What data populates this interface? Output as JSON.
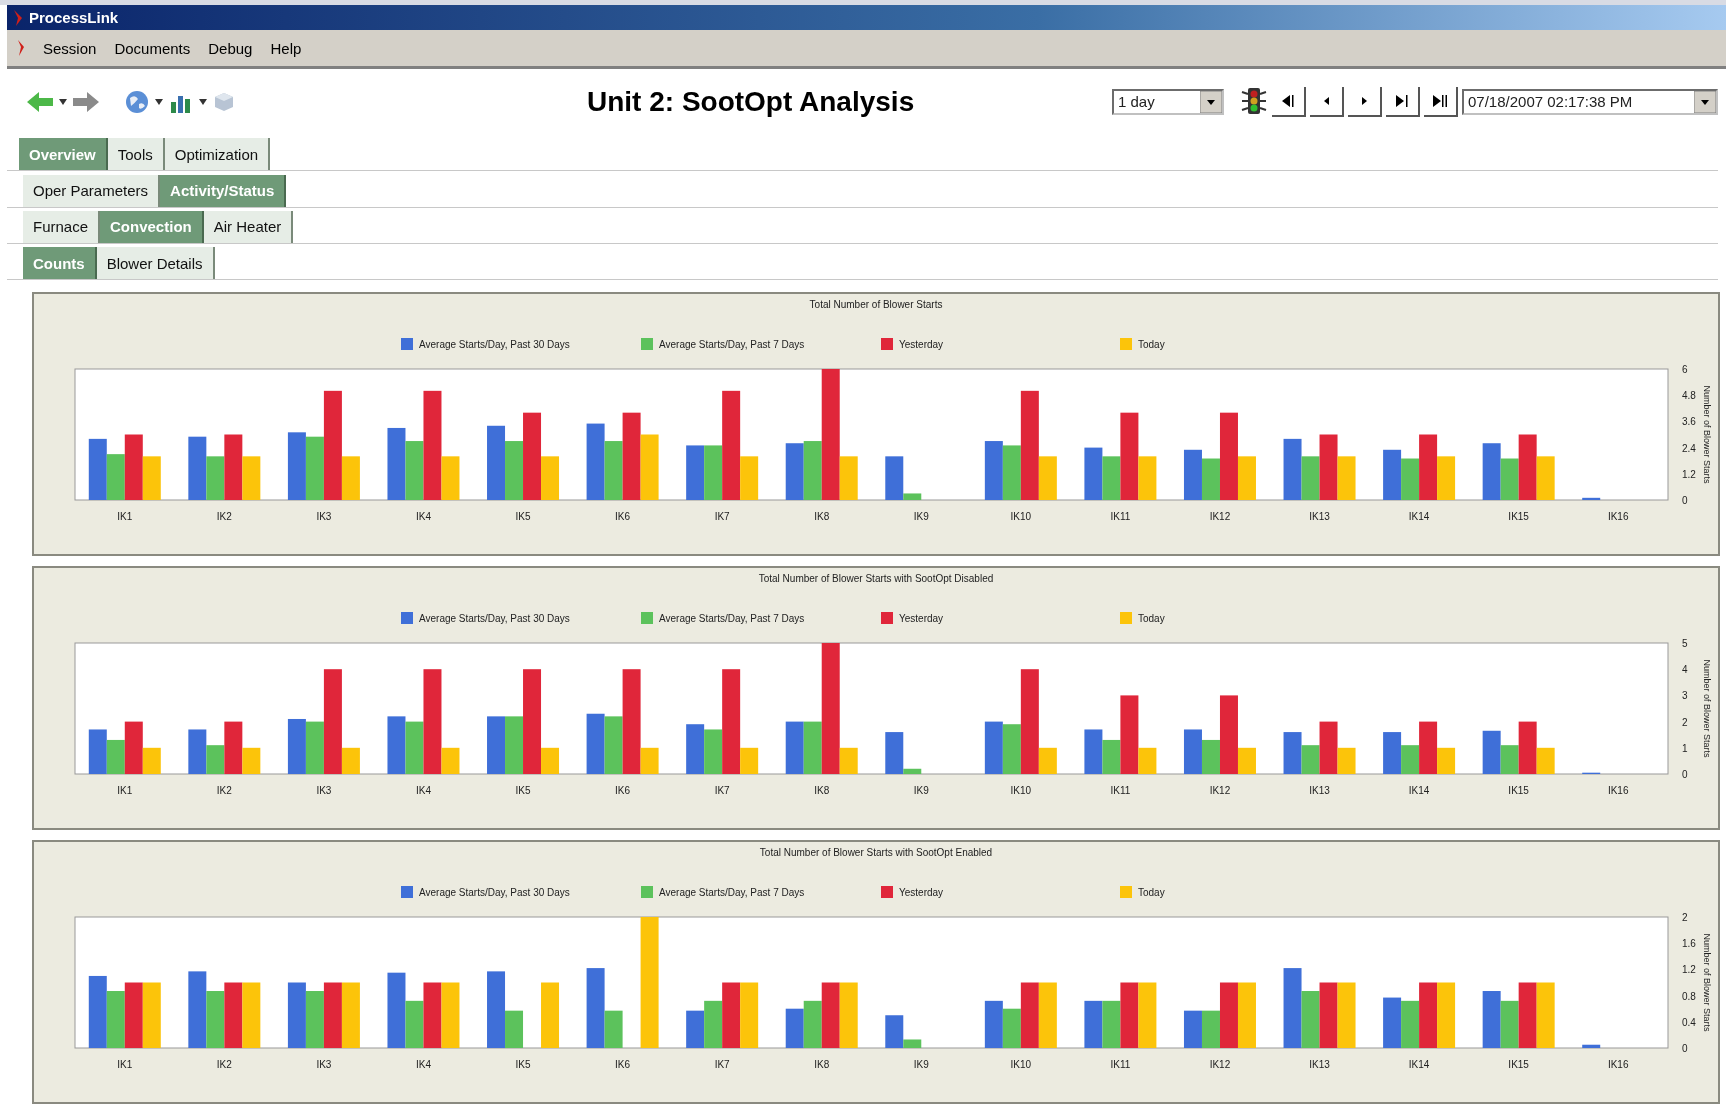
{
  "window": {
    "title": "ProcessLink"
  },
  "menu": [
    {
      "label": "Session"
    },
    {
      "label": "Documents"
    },
    {
      "label": "Debug"
    },
    {
      "label": "Help"
    }
  ],
  "page_title": "Unit 2: SootOpt Analysis",
  "time_range": {
    "value": "1 day"
  },
  "timestamp": {
    "value": "07/18/2007 02:17:38 PM"
  },
  "tab_rows": [
    [
      {
        "label": "Overview",
        "selected": true
      },
      {
        "label": "Tools",
        "selected": false
      },
      {
        "label": "Optimization",
        "selected": false
      }
    ],
    [
      {
        "label": "Oper Parameters",
        "selected": false
      },
      {
        "label": "Activity/Status",
        "selected": true
      }
    ],
    [
      {
        "label": "Furnace",
        "selected": false
      },
      {
        "label": "Convection",
        "selected": true
      },
      {
        "label": "Air Heater",
        "selected": false
      }
    ],
    [
      {
        "label": "Counts",
        "selected": true
      },
      {
        "label": "Blower Details",
        "selected": false
      }
    ]
  ],
  "charts": [
    {
      "chart_data": {
        "type": "bar",
        "title": "Total Number of Blower Starts",
        "legend": true,
        "ylabel": "Number of Blower Starts",
        "categories": [
          "IK1",
          "IK2",
          "IK3",
          "IK4",
          "IK5",
          "IK6",
          "IK7",
          "IK8",
          "IK9",
          "IK10",
          "IK11",
          "IK12",
          "IK13",
          "IK14",
          "IK15",
          "IK16"
        ],
        "ylim": [
          0,
          6
        ],
        "yticks": [
          0,
          1.2,
          2.4,
          3.6,
          4.8,
          6
        ],
        "series": [
          {
            "name": "Average Starts/Day, Past 30 Days",
            "color": "#3f6fd8",
            "values": [
              2.8,
              2.9,
              3.1,
              3.3,
              3.4,
              3.5,
              2.5,
              2.6,
              2.0,
              2.7,
              2.4,
              2.3,
              2.8,
              2.3,
              2.6,
              0.1
            ]
          },
          {
            "name": "Average Starts/Day, Past 7 Days",
            "color": "#5cc25c",
            "values": [
              2.1,
              2.0,
              2.9,
              2.7,
              2.7,
              2.7,
              2.5,
              2.7,
              0.3,
              2.5,
              2.0,
              1.9,
              2.0,
              1.9,
              1.9,
              0
            ]
          },
          {
            "name": "Yesterday",
            "color": "#e0263a",
            "values": [
              3,
              3,
              5,
              5,
              4,
              4,
              5,
              6,
              0,
              5,
              4,
              4,
              3,
              3,
              3,
              0
            ]
          },
          {
            "name": "Today",
            "color": "#fcc40a",
            "values": [
              2,
              2,
              2,
              2,
              2,
              3,
              2,
              2,
              0,
              2,
              2,
              2,
              2,
              2,
              2,
              0
            ]
          }
        ]
      }
    },
    {
      "chart_data": {
        "type": "bar",
        "title": "Total Number of Blower Starts with SootOpt Disabled",
        "legend": true,
        "ylabel": "Number of Blower Starts",
        "categories": [
          "IK1",
          "IK2",
          "IK3",
          "IK4",
          "IK5",
          "IK6",
          "IK7",
          "IK8",
          "IK9",
          "IK10",
          "IK11",
          "IK12",
          "IK13",
          "IK14",
          "IK15",
          "IK16"
        ],
        "ylim": [
          0,
          5
        ],
        "yticks": [
          0,
          1,
          2,
          3,
          4,
          5
        ],
        "series": [
          {
            "name": "Average Starts/Day, Past 30 Days",
            "color": "#3f6fd8",
            "values": [
              1.7,
              1.7,
              2.1,
              2.2,
              2.2,
              2.3,
              1.9,
              2.0,
              1.6,
              2.0,
              1.7,
              1.7,
              1.6,
              1.6,
              1.65,
              0.05
            ]
          },
          {
            "name": "Average Starts/Day, Past 7 Days",
            "color": "#5cc25c",
            "values": [
              1.3,
              1.1,
              2.0,
              2.0,
              2.2,
              2.2,
              1.7,
              2.0,
              0.2,
              1.9,
              1.3,
              1.3,
              1.1,
              1.1,
              1.1,
              0
            ]
          },
          {
            "name": "Yesterday",
            "color": "#e0263a",
            "values": [
              2,
              2,
              4,
              4,
              4,
              4,
              4,
              5,
              0,
              4,
              3,
              3,
              2,
              2,
              2,
              0
            ]
          },
          {
            "name": "Today",
            "color": "#fcc40a",
            "values": [
              1,
              1,
              1,
              1,
              1,
              1,
              1,
              1,
              0,
              1,
              1,
              1,
              1,
              1,
              1,
              0
            ]
          }
        ]
      }
    },
    {
      "chart_data": {
        "type": "bar",
        "title": "Total Number of Blower Starts with SootOpt Enabled",
        "legend": true,
        "ylabel": "Number of Blower Starts",
        "categories": [
          "IK1",
          "IK2",
          "IK3",
          "IK4",
          "IK5",
          "IK6",
          "IK7",
          "IK8",
          "IK9",
          "IK10",
          "IK11",
          "IK12",
          "IK13",
          "IK14",
          "IK15",
          "IK16"
        ],
        "ylim": [
          0,
          2
        ],
        "yticks": [
          0,
          0.4,
          0.8,
          1.2,
          1.6,
          2
        ],
        "series": [
          {
            "name": "Average Starts/Day, Past 30 Days",
            "color": "#3f6fd8",
            "values": [
              1.1,
              1.17,
              1.0,
              1.15,
              1.17,
              1.22,
              0.57,
              0.6,
              0.5,
              0.72,
              0.72,
              0.57,
              1.22,
              0.77,
              0.87,
              0.05
            ]
          },
          {
            "name": "Average Starts/Day, Past 7 Days",
            "color": "#5cc25c",
            "values": [
              0.87,
              0.87,
              0.87,
              0.72,
              0.57,
              0.57,
              0.72,
              0.72,
              0.13,
              0.6,
              0.72,
              0.57,
              0.87,
              0.72,
              0.72,
              0
            ]
          },
          {
            "name": "Yesterday",
            "color": "#e0263a",
            "values": [
              1,
              1,
              1,
              1,
              0,
              0,
              1,
              1,
              0,
              1,
              1,
              1,
              1,
              1,
              1,
              0
            ]
          },
          {
            "name": "Today",
            "color": "#fcc40a",
            "values": [
              1,
              1,
              1,
              1,
              1,
              2,
              1,
              1,
              0,
              1,
              1,
              1,
              1,
              1,
              1,
              0
            ]
          }
        ]
      }
    }
  ]
}
